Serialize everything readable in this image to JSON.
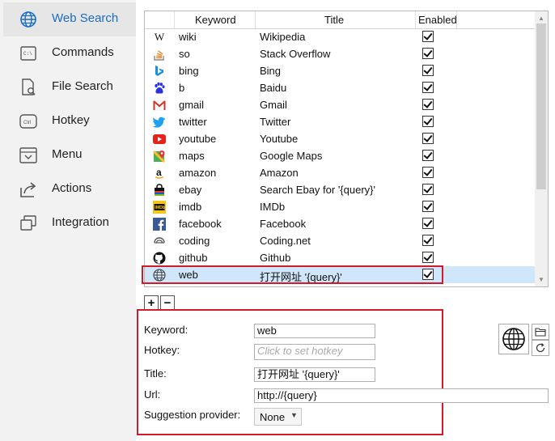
{
  "sidebar": {
    "items": [
      {
        "label": "Web Search",
        "icon": "globe-icon"
      },
      {
        "label": "Commands",
        "icon": "command-icon"
      },
      {
        "label": "File Search",
        "icon": "file-search-icon"
      },
      {
        "label": "Hotkey",
        "icon": "keyboard-icon"
      },
      {
        "label": "Menu",
        "icon": "menu-icon"
      },
      {
        "label": "Actions",
        "icon": "share-icon"
      },
      {
        "label": "Integration",
        "icon": "window-icon"
      }
    ]
  },
  "grid": {
    "columns": [
      "Keyword",
      "Title",
      "Enabled"
    ],
    "rows": [
      {
        "keyword": "wiki",
        "title": "Wikipedia",
        "enabled": true,
        "icon": "wikipedia-icon"
      },
      {
        "keyword": "so",
        "title": "Stack Overflow",
        "enabled": true,
        "icon": "stackoverflow-icon"
      },
      {
        "keyword": "bing",
        "title": "Bing",
        "enabled": true,
        "icon": "bing-icon"
      },
      {
        "keyword": "b",
        "title": "Baidu",
        "enabled": true,
        "icon": "baidu-icon"
      },
      {
        "keyword": "gmail",
        "title": "Gmail",
        "enabled": true,
        "icon": "gmail-icon"
      },
      {
        "keyword": "twitter",
        "title": "Twitter",
        "enabled": true,
        "icon": "twitter-icon"
      },
      {
        "keyword": "youtube",
        "title": "Youtube",
        "enabled": true,
        "icon": "youtube-icon"
      },
      {
        "keyword": "maps",
        "title": "Google Maps",
        "enabled": true,
        "icon": "maps-icon"
      },
      {
        "keyword": "amazon",
        "title": "Amazon",
        "enabled": true,
        "icon": "amazon-icon"
      },
      {
        "keyword": "ebay",
        "title": "Search Ebay for '{query}'",
        "enabled": true,
        "icon": "shopping-bag-icon"
      },
      {
        "keyword": "imdb",
        "title": "IMDb",
        "enabled": true,
        "icon": "imdb-icon"
      },
      {
        "keyword": "facebook",
        "title": "Facebook",
        "enabled": true,
        "icon": "facebook-icon"
      },
      {
        "keyword": "coding",
        "title": "Coding.net",
        "enabled": true,
        "icon": "coding-icon"
      },
      {
        "keyword": "github",
        "title": "Github",
        "enabled": true,
        "icon": "github-icon"
      },
      {
        "keyword": "web",
        "title": "打开网址 '{query}'",
        "enabled": true,
        "icon": "globe-icon",
        "selected": true
      }
    ]
  },
  "buttons": {
    "add": "+",
    "remove": "−"
  },
  "form": {
    "keyword_label": "Keyword:",
    "keyword_value": "web",
    "hotkey_label": "Hotkey:",
    "hotkey_placeholder": "Click to set hotkey",
    "title_label": "Title:",
    "title_value": "打开网址 '{query}'",
    "url_label": "Url:",
    "url_value": "http://{query}",
    "suggestion_label": "Suggestion provider:",
    "suggestion_value": "None"
  },
  "colors": {
    "accent": "#1a6dc8",
    "highlight": "#d11a2a",
    "selection": "#cfe6fb"
  }
}
